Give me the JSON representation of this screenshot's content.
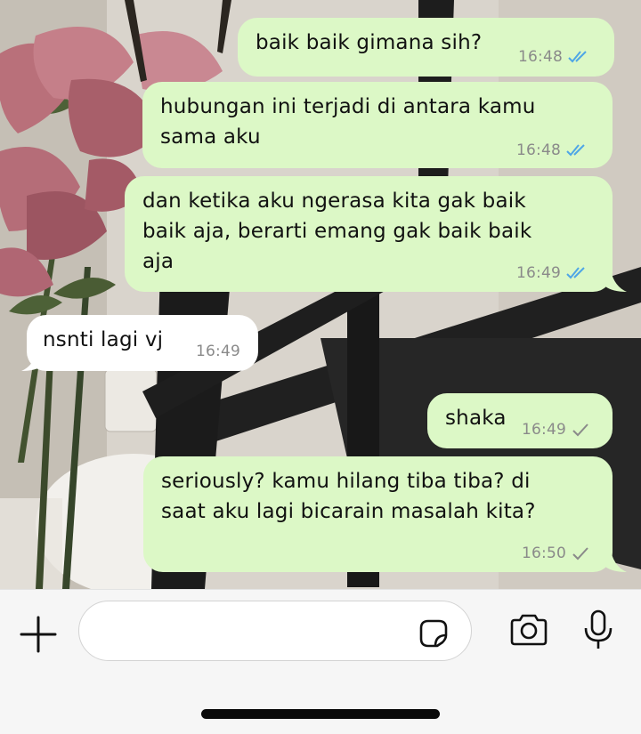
{
  "chat": {
    "messages": [
      {
        "direction": "out",
        "lines": [
          "baik baik gimana sih?"
        ],
        "time": "16:48",
        "status": "read"
      },
      {
        "direction": "out",
        "lines": [
          "hubungan ini terjadi di antara kamu",
          "sama aku"
        ],
        "time": "16:48",
        "status": "read"
      },
      {
        "direction": "out",
        "lines": [
          "dan ketika aku ngerasa kita gak baik",
          "baik aja, berarti emang gak baik baik",
          "aja"
        ],
        "time": "16:49",
        "status": "read"
      },
      {
        "direction": "in",
        "lines": [
          "nsnti lagi vj"
        ],
        "time": "16:49"
      },
      {
        "direction": "out",
        "lines": [
          "shaka"
        ],
        "time": "16:49",
        "status": "sent"
      },
      {
        "direction": "out",
        "lines": [
          "seriously? kamu hilang tiba tiba? di",
          "saat aku lagi bicarain masalah kita?"
        ],
        "time": "16:50",
        "status": "sent"
      }
    ]
  },
  "composer": {
    "value": "",
    "icons": [
      "plus-icon",
      "sticker-icon",
      "camera-icon",
      "microphone-icon"
    ]
  },
  "colors": {
    "outgoing_bubble": "#dcf8c6",
    "incoming_bubble": "#ffffff",
    "read_tick": "#4fa6e6",
    "sent_tick": "#8a8a8a",
    "input_bar": "#f6f6f6"
  }
}
